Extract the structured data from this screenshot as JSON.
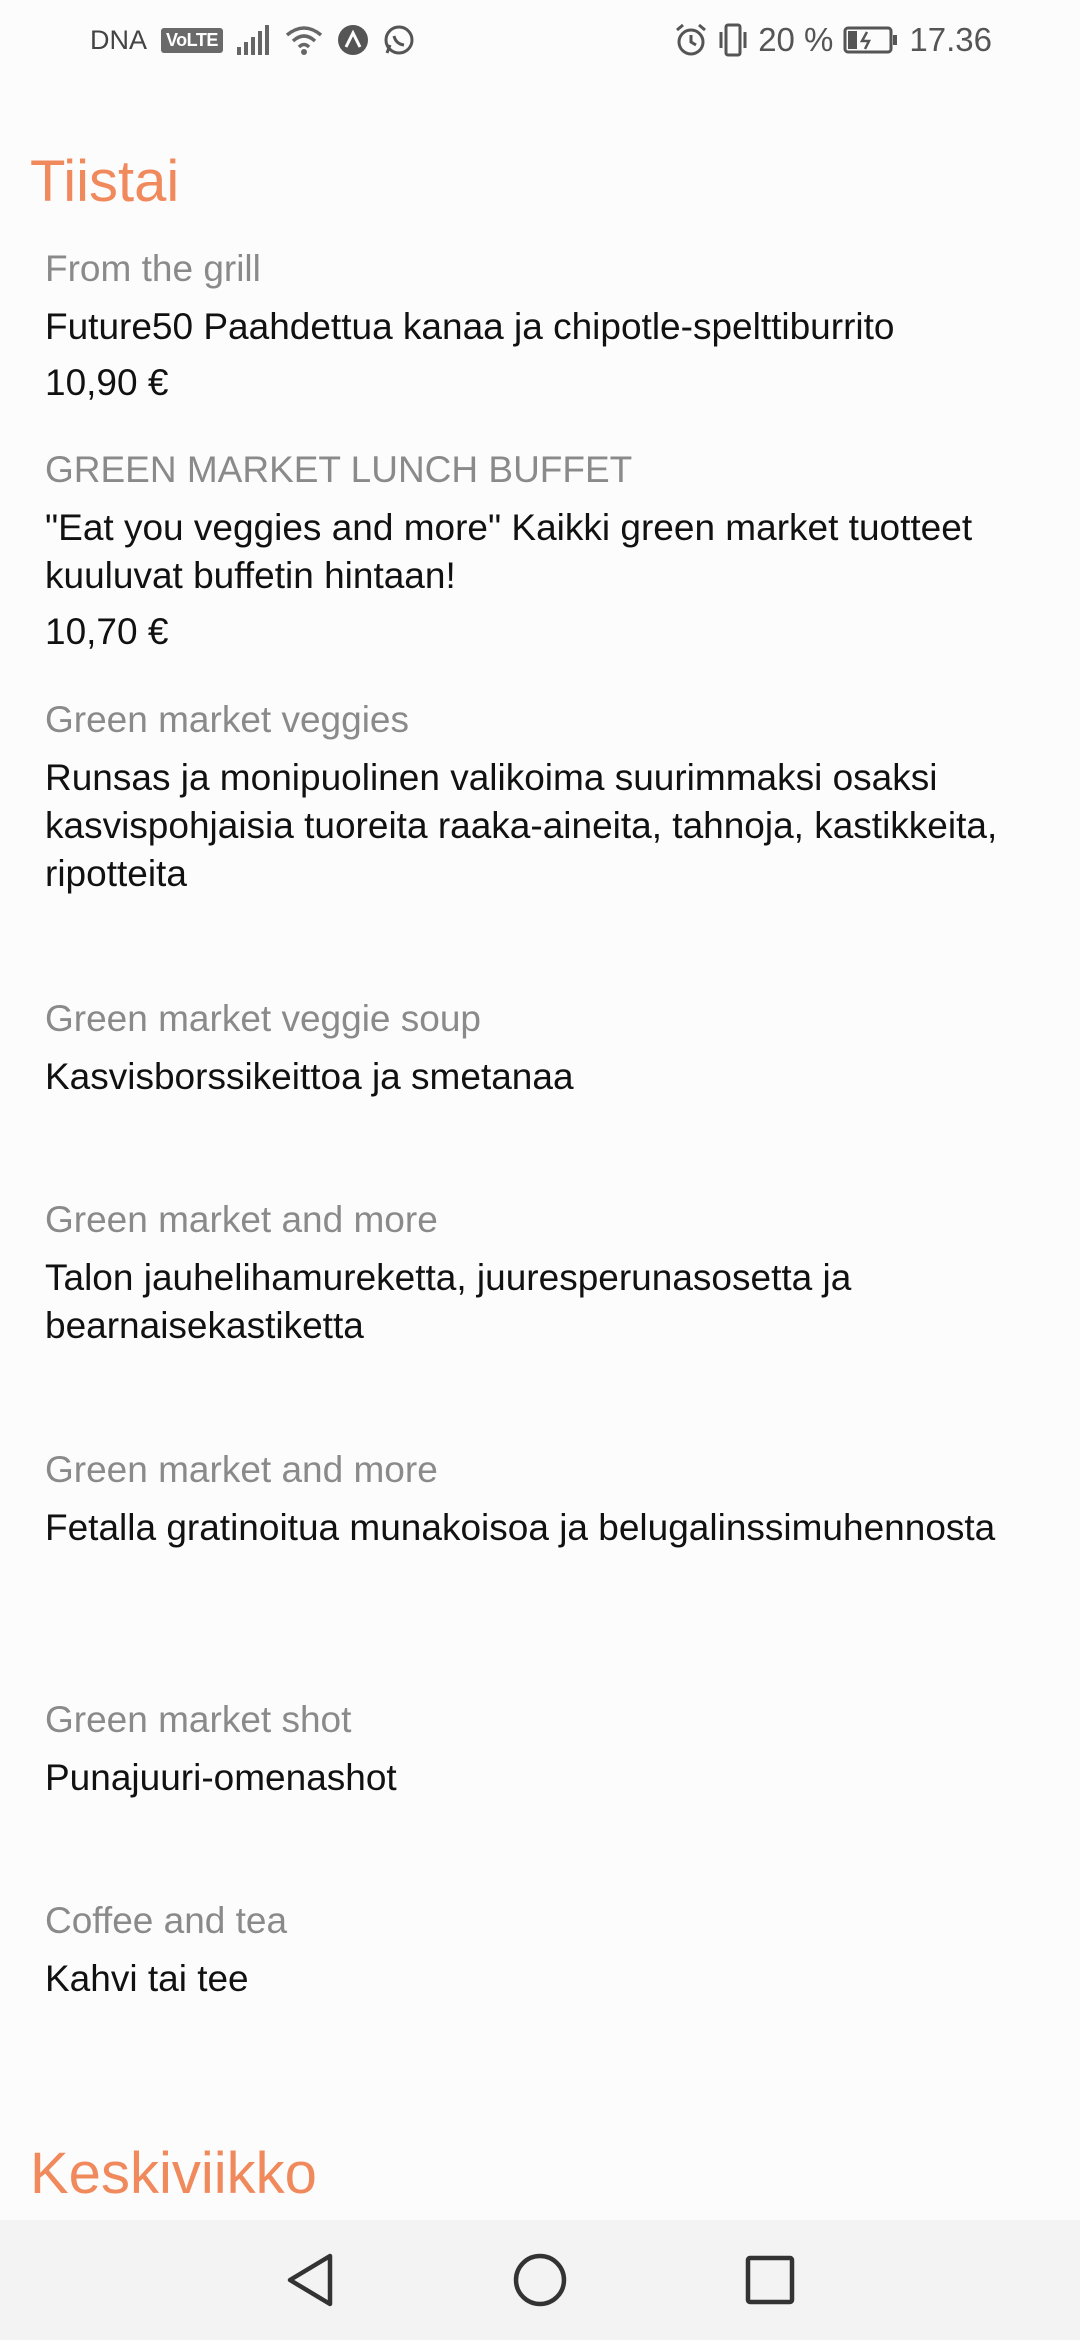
{
  "status_bar": {
    "carrier": "DNA",
    "volte": "VoLTE",
    "battery_percent": "20 %",
    "time": "17.36",
    "icons": [
      "signal-icon",
      "wifi-icon",
      "app-notification-icon",
      "whatsapp-icon",
      "alarm-icon",
      "vibrate-icon",
      "battery-charging-icon"
    ]
  },
  "days": [
    {
      "name": "Tiistai",
      "items": [
        {
          "category": "From the grill",
          "description": "Future50 Paahdettua kanaa ja chipotle-speltti­burrito",
          "price": "10,90 €"
        },
        {
          "category": "GREEN MARKET LUNCH BUFFET",
          "description": "\"Eat you veggies and more\" Kaikki green market tuotteet kuuluvat buffetin hintaan!",
          "price": "10,70 €"
        },
        {
          "category": "Green market veggies",
          "description": "Runsas ja monipuolinen valikoima suurimmaksi osaksi kasvispohjaisia tuoreita raaka-aineita, tahnoja, kastikkeita, ripotteita"
        },
        {
          "category": "Green market veggie soup",
          "description": "Kasvisborssikeittoa ja smetanaa"
        },
        {
          "category": "Green market and more",
          "description": "Talon jauhelihamureketta, juuresperunasosetta ja bearnaisekastiketta"
        },
        {
          "category": "Green market and more",
          "description": "Fetalla gratinoitua munakoisoa ja belugalinssimuhennosta"
        },
        {
          "category": "Green market shot",
          "description": "Punajuuri-omenashot"
        },
        {
          "category": "Coffee and tea",
          "description": "Kahvi tai tee"
        }
      ]
    },
    {
      "name": "Keskiviikko"
    }
  ],
  "nav": {
    "back": "back-icon",
    "home": "home-icon",
    "recents": "recents-icon"
  },
  "colors": {
    "day_title": "#f08a5d",
    "category": "#8a8a8a",
    "text": "#111111",
    "background": "#fcfcfc"
  }
}
